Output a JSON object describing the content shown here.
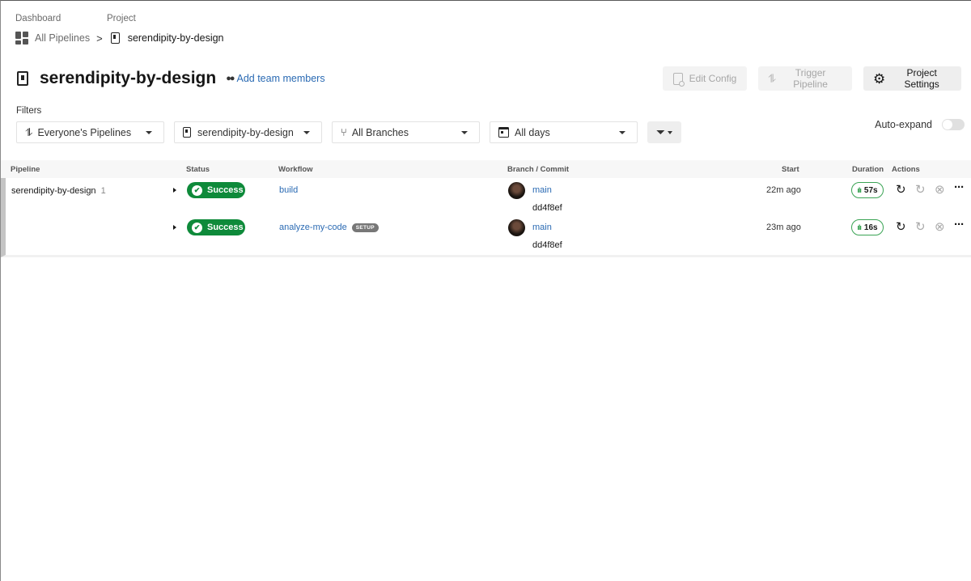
{
  "breadcrumb": {
    "labels": [
      "Dashboard",
      "Project"
    ],
    "all_pipelines": "All Pipelines",
    "separator": ">",
    "project": "serendipity-by-design"
  },
  "header": {
    "title": "serendipity-by-design",
    "add_team": "Add team members",
    "buttons": {
      "edit_config": "Edit Config",
      "trigger_pipeline": "Trigger Pipeline",
      "project_settings": "Project Settings"
    }
  },
  "filters": {
    "label": "Filters",
    "pipelines": "Everyone's Pipelines",
    "project": "serendipity-by-design",
    "branches": "All Branches",
    "days": "All days",
    "auto_expand": "Auto-expand",
    "auto_expand_on": false
  },
  "table": {
    "columns": {
      "pipeline": "Pipeline",
      "status": "Status",
      "workflow": "Workflow",
      "branch_commit": "Branch / Commit",
      "start": "Start",
      "duration": "Duration",
      "actions": "Actions"
    },
    "group": {
      "pipeline_name": "serendipity-by-design",
      "pipeline_number": "1",
      "rows": [
        {
          "status": "Success",
          "workflow": "build",
          "tag": "",
          "branch": "main",
          "commit": "dd4f8ef",
          "start": "22m ago",
          "duration": "57s"
        },
        {
          "status": "Success",
          "workflow": "analyze-my-code",
          "tag": "SETUP",
          "branch": "main",
          "commit": "dd4f8ef",
          "start": "23m ago",
          "duration": "16s"
        }
      ]
    }
  },
  "colors": {
    "success": "#0e8a3a",
    "link": "#2a6ab3",
    "duration_border": "#3aa354"
  }
}
